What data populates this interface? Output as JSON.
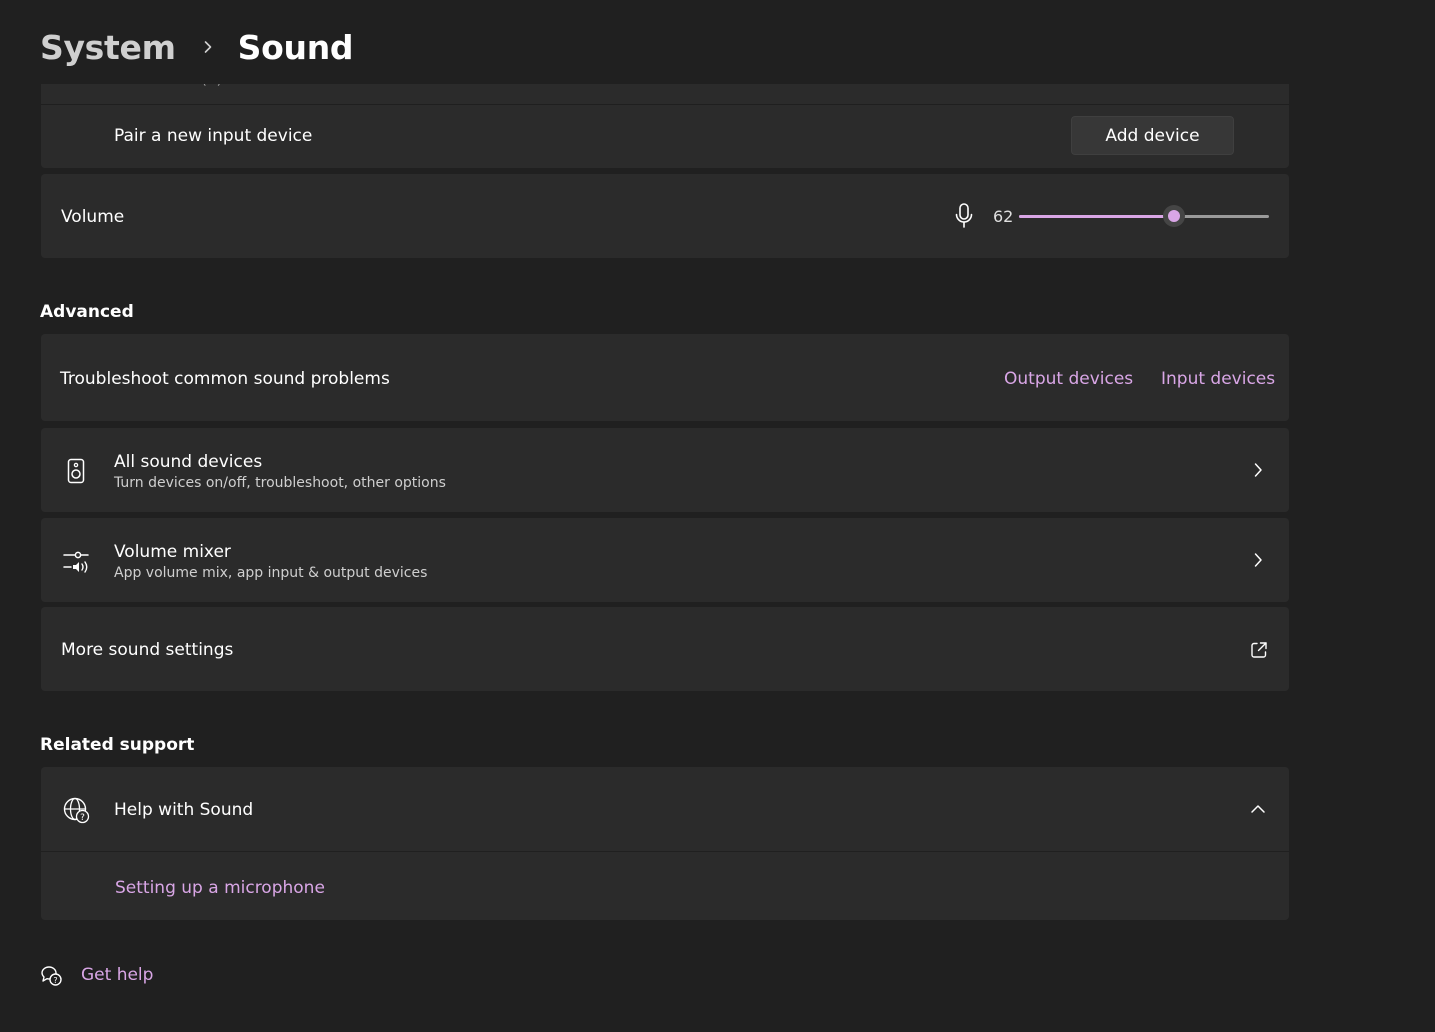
{
  "header": {
    "breadcrumb_parent": "System",
    "breadcrumb_current": "Sound"
  },
  "input_device": {
    "partial_subtitle": "Realtek(R) Audio",
    "pair_label": "Pair a new input device",
    "add_button": "Add device"
  },
  "volume": {
    "label": "Volume",
    "value": "62",
    "level_percent": 62
  },
  "advanced": {
    "section_title": "Advanced",
    "troubleshoot": {
      "label": "Troubleshoot common sound problems",
      "output_link": "Output devices",
      "input_link": "Input devices"
    },
    "all_devices": {
      "title": "All sound devices",
      "subtitle": "Turn devices on/off, troubleshoot, other options"
    },
    "volume_mixer": {
      "title": "Volume mixer",
      "subtitle": "App volume mix, app input & output devices"
    },
    "more_settings": {
      "title": "More sound settings"
    }
  },
  "related_support": {
    "section_title": "Related support",
    "help_title": "Help with Sound",
    "help_link": "Setting up a microphone"
  },
  "footer": {
    "get_help": "Get help"
  },
  "colors": {
    "accent": "#d9a6e6",
    "background": "#202020",
    "card": "#2b2b2b"
  }
}
